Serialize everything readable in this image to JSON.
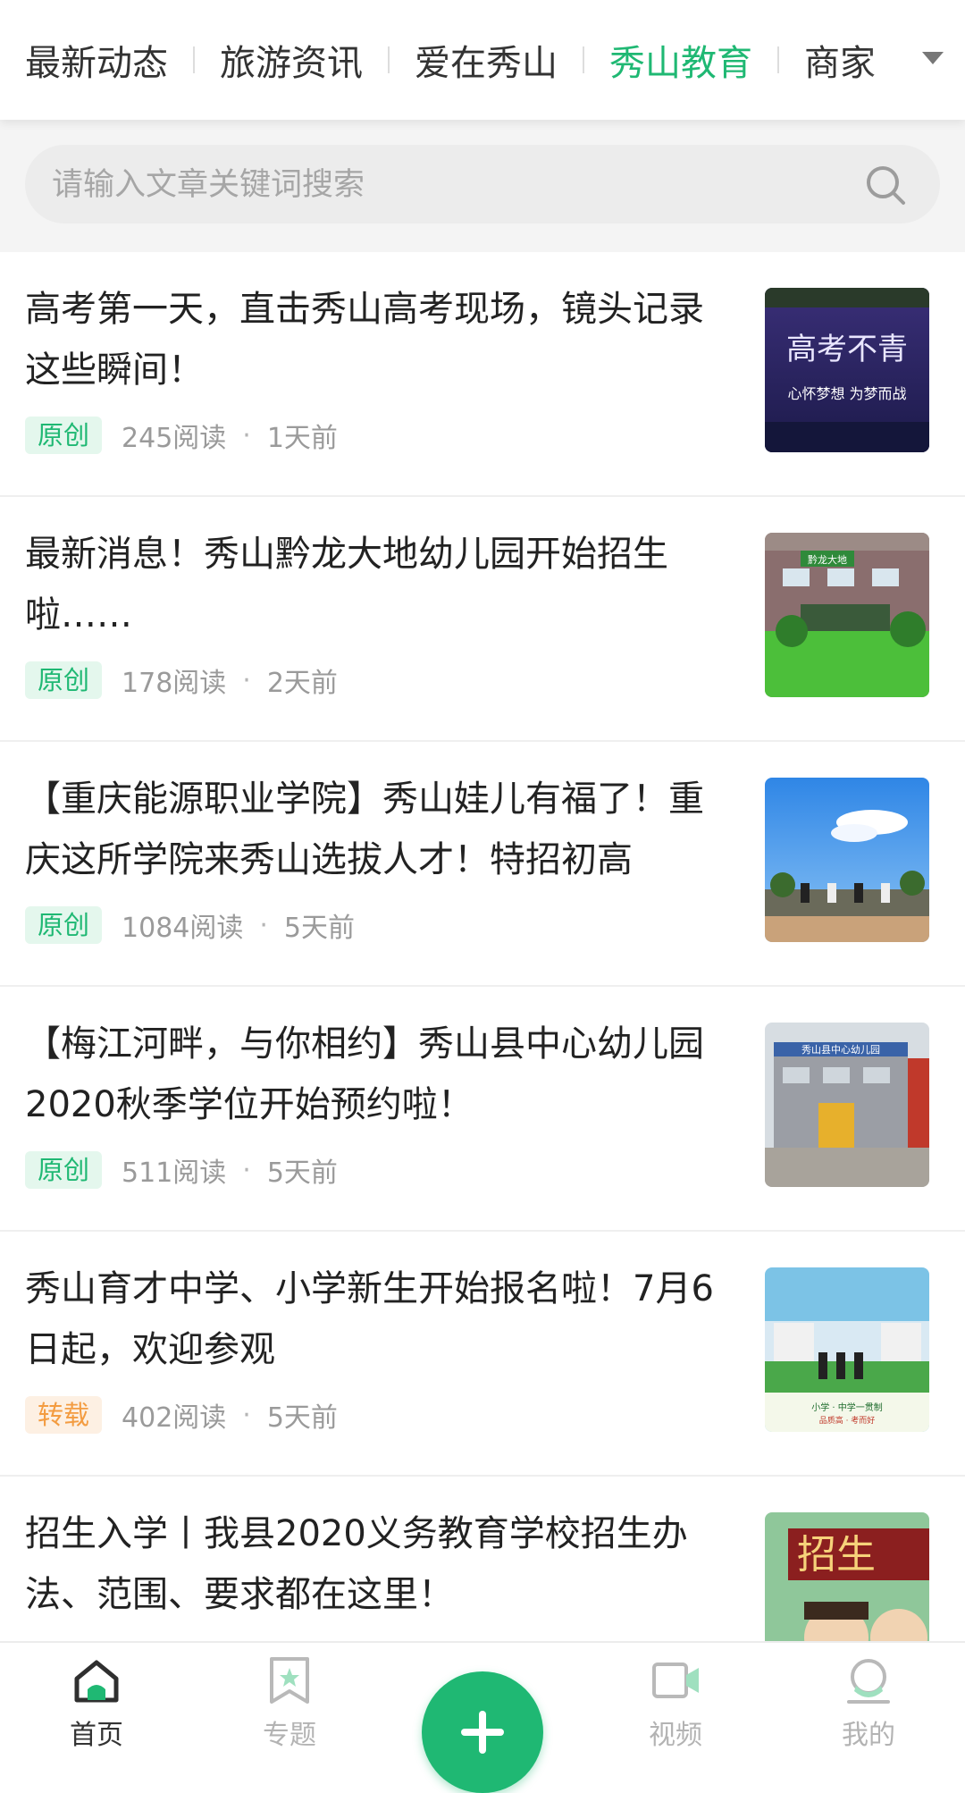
{
  "tabs": {
    "items": [
      "最新动态",
      "旅游资讯",
      "爱在秀山",
      "秀山教育",
      "商家"
    ],
    "active_index": 3
  },
  "search": {
    "placeholder": "请输入文章关键词搜索"
  },
  "articles": [
    {
      "title": "高考第一天，直击秀山高考现场，镜头记录这些瞬间！",
      "tag": "原创",
      "reads": "245阅读",
      "time": "1天前",
      "thumb_text": "高考不青",
      "thumb_sub": "心怀梦想 为梦而战"
    },
    {
      "title": "最新消息！秀山黔龙大地幼儿园开始招生啦……",
      "tag": "原创",
      "reads": "178阅读",
      "time": "2天前",
      "thumb_text": "黔龙大地"
    },
    {
      "title": "【重庆能源职业学院】秀山娃儿有福了！重庆这所学院来秀山选拔人才！特招初高",
      "tag": "原创",
      "reads": "1084阅读",
      "time": "5天前"
    },
    {
      "title": "【梅江河畔，与你相约】秀山县中心幼儿园2020秋季学位开始预约啦！",
      "tag": "原创",
      "reads": "511阅读",
      "time": "5天前",
      "thumb_text": "秀山县中心幼儿园"
    },
    {
      "title": "秀山育才中学、小学新生开始报名啦！7月6日起，欢迎参观",
      "tag": "转载",
      "reads": "402阅读",
      "time": "5天前",
      "thumb_text": "小学 · 中学一贯制",
      "thumb_sub": "品质高 · 考而好"
    },
    {
      "title": "招生入学丨我县2020义务教育学校招生办法、范围、要求都在这里！",
      "tag": "",
      "reads": "",
      "time": "",
      "thumb_text": "招生"
    }
  ],
  "nav": {
    "home": "首页",
    "topics": "专题",
    "video": "视频",
    "mine": "我的"
  },
  "colors": {
    "accent": "#1fb873",
    "repost": "#f39c41"
  },
  "icons": [
    "search-icon",
    "home-icon",
    "bookmark-icon",
    "plus-icon",
    "video-icon",
    "profile-icon",
    "chevron-down-icon"
  ]
}
